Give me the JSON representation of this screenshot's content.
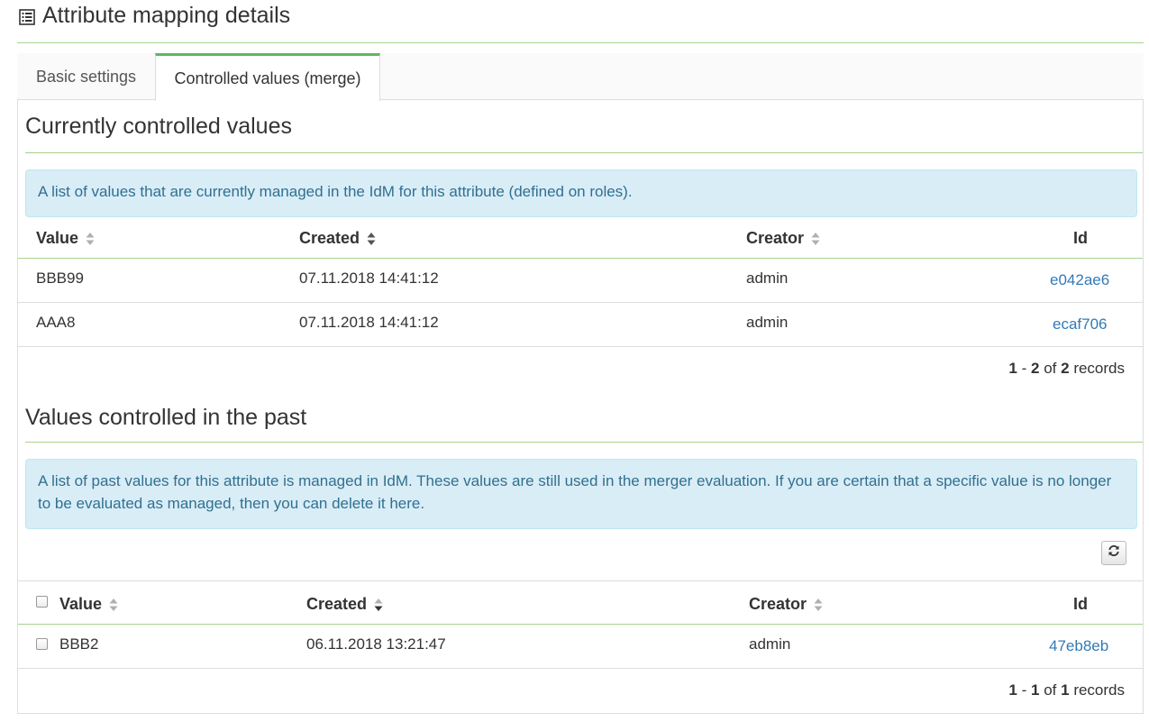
{
  "header": {
    "title": "Attribute mapping details",
    "icon": "list-icon"
  },
  "tabs": [
    {
      "label": "Basic settings",
      "active": false
    },
    {
      "label": "Controlled values (merge)",
      "active": true
    }
  ],
  "current": {
    "title": "Currently controlled values",
    "info": "A list of values that are currently managed in the IdM for this attribute (defined on roles).",
    "columns": {
      "value": "Value",
      "created": "Created",
      "creator": "Creator",
      "id": "Id"
    },
    "rows": [
      {
        "value": "BBB99",
        "created": "07.11.2018 14:41:12",
        "creator": "admin",
        "id": "e042ae6"
      },
      {
        "value": "AAA8",
        "created": "07.11.2018 14:41:12",
        "creator": "admin",
        "id": "ecaf706"
      }
    ],
    "pager": {
      "from": "1",
      "to": "2",
      "of_label": "of",
      "total": "2",
      "records_label": "records"
    }
  },
  "past": {
    "title": "Values controlled in the past",
    "info": "A list of past values for this attribute is managed in IdM. These values are still used in the merger evaluation. If you are certain that a specific value is no longer to be evaluated as managed, then you can delete it here.",
    "columns": {
      "value": "Value",
      "created": "Created",
      "creator": "Creator",
      "id": "Id"
    },
    "rows": [
      {
        "value": "BBB2",
        "created": "06.11.2018 13:21:47",
        "creator": "admin",
        "id": "47eb8eb"
      }
    ],
    "pager": {
      "from": "1",
      "to": "1",
      "of_label": "of",
      "total": "1",
      "records_label": "records"
    },
    "refresh_icon": "refresh-icon"
  },
  "colors": {
    "accent_green": "#5cb85c",
    "divider_green": "#a9d18e",
    "info_bg": "#d9edf7",
    "link": "#337ab7"
  }
}
